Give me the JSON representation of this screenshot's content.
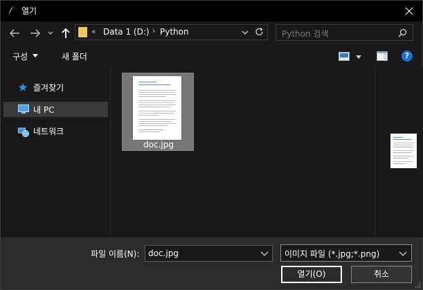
{
  "window": {
    "title": "열기",
    "close_glyph": "✕"
  },
  "nav": {
    "address": {
      "overflow_glyph": "«",
      "drive": "Data 1 (D:)",
      "separator": "›",
      "folder": "Python"
    },
    "search": {
      "placeholder": "Python 검색"
    }
  },
  "toolbar": {
    "organize": "구성",
    "new_folder": "새 폴더",
    "help": "?"
  },
  "sidebar": {
    "items": [
      {
        "label": "즐겨찾기",
        "icon": "star-icon"
      },
      {
        "label": "내 PC",
        "icon": "pc-icon",
        "selected": true
      },
      {
        "label": "네트워크",
        "icon": "network-icon"
      }
    ]
  },
  "files": [
    {
      "name": "doc.jpg",
      "selected": true
    }
  ],
  "bottom": {
    "filename_label": "파일 이름(N):",
    "filename_value": "doc.jpg",
    "filetype": "이미지 파일 (*.jpg;*.png)",
    "open_label": "열기(O)",
    "cancel_label": "취소"
  },
  "colors": {
    "accent_blue": "#1e6fd2",
    "folder_yellow": "#f1c65a",
    "selected_bg": "#3a3a3a",
    "tile_bg": "#777777"
  }
}
